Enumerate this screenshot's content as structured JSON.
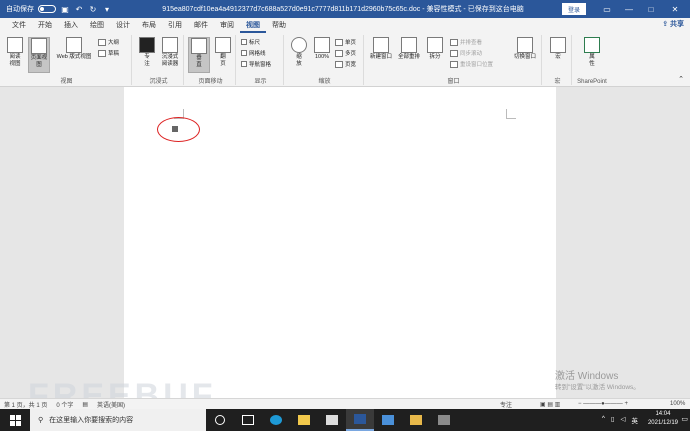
{
  "titlebar": {
    "autosave": "自动保存",
    "autosave_state": "关",
    "title": "915ea807cdf10ea4a4912377d7c688a527d0e91c7777d811b171d2960b75c65c.doc  -  兼容性模式  -  已保存到这台电脑",
    "login": "登录"
  },
  "menu": {
    "tabs": [
      "文件",
      "开始",
      "插入",
      "绘图",
      "设计",
      "布局",
      "引用",
      "邮件",
      "审阅",
      "视图",
      "帮助"
    ],
    "active_index": 9,
    "share": "共享"
  },
  "ribbon": {
    "views": {
      "read": "阅读\n视图",
      "print": "页面视图",
      "web": "Web 版式视图",
      "outline": "大纲",
      "draft": "草稿",
      "label": "视图"
    },
    "immersive": {
      "focus": "专\n注",
      "reader": "沉浸式\n阅读器",
      "label": "沉浸式"
    },
    "pagemove": {
      "vertical": "垂\n直",
      "side": "翻\n页",
      "label": "页面移动"
    },
    "show": {
      "ruler": "标尺",
      "grid": "网格线",
      "nav": "导航窗格",
      "label": "显示"
    },
    "zoom": {
      "zoom": "缩\n放",
      "hundred": "100%",
      "one": "单页",
      "multi": "多页",
      "width": "页宽",
      "label": "缩放"
    },
    "window": {
      "new": "新建窗口",
      "arrange": "全部重排",
      "split": "拆分",
      "side": "并排查看",
      "sync": "同步滚动",
      "reset": "重设窗口位置",
      "switch": "切换窗口",
      "label": "窗口"
    },
    "macro": {
      "macro": "宏",
      "label": "宏"
    },
    "sharepoint": {
      "props": "属\n性",
      "label": "SharePoint"
    }
  },
  "statusbar": {
    "page": "第 1 页，共 1 页",
    "words": "0 个字",
    "lang": "英语(美国)",
    "focus": "专注",
    "zoom": "100%"
  },
  "watermark": {
    "line1": "激活 Windows",
    "line2": "转到\"设置\"以激活 Windows。"
  },
  "brand_watermark": "FREEBUF",
  "taskbar": {
    "search_placeholder": "在这里输入你要搜索的内容",
    "time": "14:04",
    "date": "2021/12/19",
    "ime": "英"
  },
  "colors": {
    "accent": "#2b579a",
    "annotation": "#dd2222"
  }
}
